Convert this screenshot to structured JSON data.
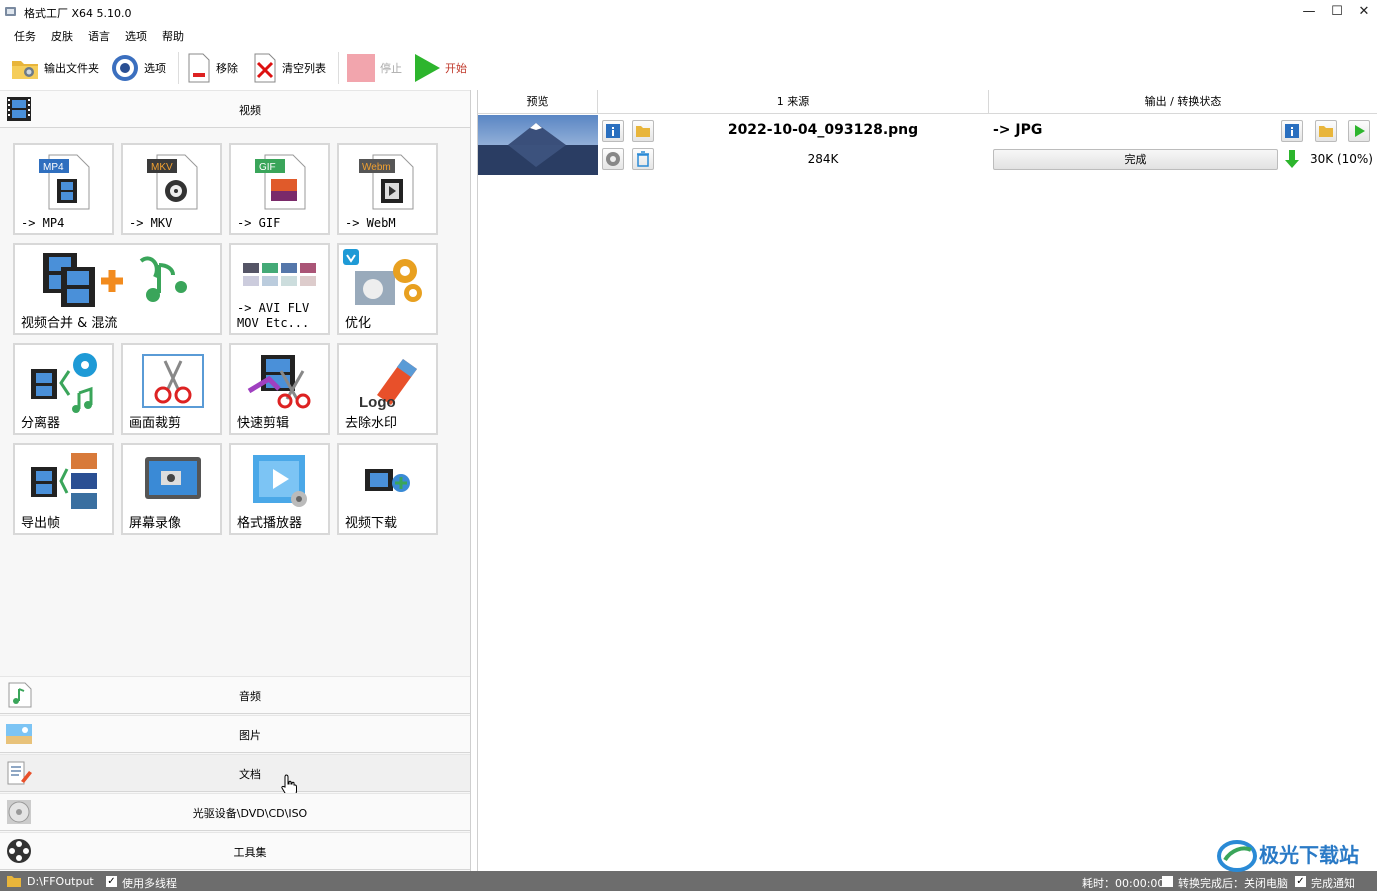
{
  "window": {
    "title": "格式工厂 X64 5.10.0",
    "min": "—",
    "max": "☐",
    "close": "✕"
  },
  "menu": [
    "任务",
    "皮肤",
    "语言",
    "选项",
    "帮助"
  ],
  "toolbar": {
    "output_folder": "输出文件夹",
    "options": "选项",
    "remove": "移除",
    "clear_list": "清空列表",
    "stop": "停止",
    "start": "开始"
  },
  "categories": {
    "video": "视频",
    "audio": "音频",
    "picture": "图片",
    "document": "文档",
    "disc": "光驱设备\\DVD\\CD\\ISO",
    "tools": "工具集"
  },
  "video_tools": [
    "-> MP4",
    "-> MKV",
    "-> GIF",
    "-> WebM",
    "视频合并 & 混流",
    "-> AVI FLV\nMOV Etc...",
    "优化",
    "分离器",
    "画面裁剪",
    "快速剪辑",
    "去除水印",
    "导出帧",
    "屏幕录像",
    "格式播放器",
    "视频下载"
  ],
  "badges": {
    "mp4": "MP4",
    "mkv": "MKV",
    "gif": "GIF",
    "webm": "Webm",
    "logo": "Logo"
  },
  "columns": {
    "preview": "预览",
    "source": "1 来源",
    "output": "输出 / 转换状态"
  },
  "task": {
    "filename": "2022-10-04_093128.png",
    "size": "284K",
    "output_format": "-> JPG",
    "status": "完成",
    "output_size": "30K  (10%)"
  },
  "statusbar": {
    "output_path": "D:\\FFOutput",
    "multithread": "使用多线程",
    "elapsed": "耗时：00:00:00",
    "after_done": "转换完成后：关闭电脑",
    "notify": "完成通知"
  },
  "watermark": "极光下载站",
  "colors": {
    "accent_green": "#2db52d",
    "progress_bg": "#e8e8e8",
    "status_bg": "#6d6d6d"
  }
}
